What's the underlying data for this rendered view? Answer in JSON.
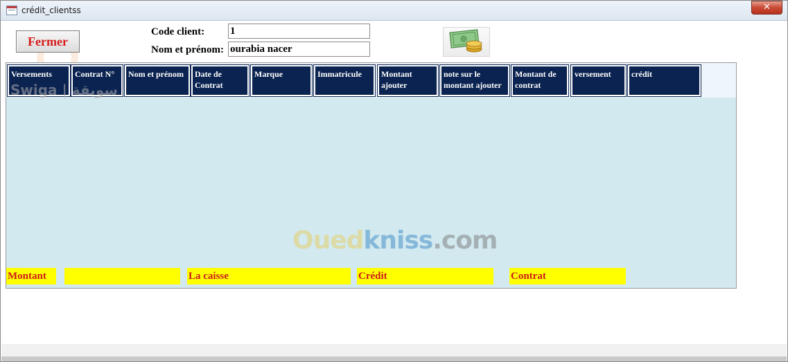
{
  "window": {
    "title": "crédit_clientss",
    "close_glyph": "✕"
  },
  "form": {
    "fermer_label": "Fermer",
    "code_client_label": "Code client:",
    "code_client_value": "1",
    "nom_label": "Nom et prénom:",
    "nom_value": "ourabia nacer",
    "money_icon": "money-coins-icon"
  },
  "subform": {
    "columns": [
      "Versements",
      "Contrat N°",
      "Nom et prénom",
      "Date de Contrat",
      "Marque",
      "Immatricule",
      "Montant ajouter",
      "note sur le montant ajouter",
      "Montant de contrat",
      "versement",
      "crédit"
    ],
    "footer": {
      "montant_label": "Montant",
      "montant_value": "",
      "caisse_label": "La caisse",
      "credit_label": "Crédit",
      "contrat_label": "Contrat"
    }
  },
  "watermarks": {
    "brand_a": "Oued",
    "brand_b": "kniss",
    "brand_c": ".com",
    "swiga": "Swiga | سويقة"
  },
  "colors": {
    "header_bg": "#0b2350",
    "footer_bg": "#ffff00",
    "footer_text": "#cc1b1b",
    "detail_bg": "#d2e9ef"
  }
}
